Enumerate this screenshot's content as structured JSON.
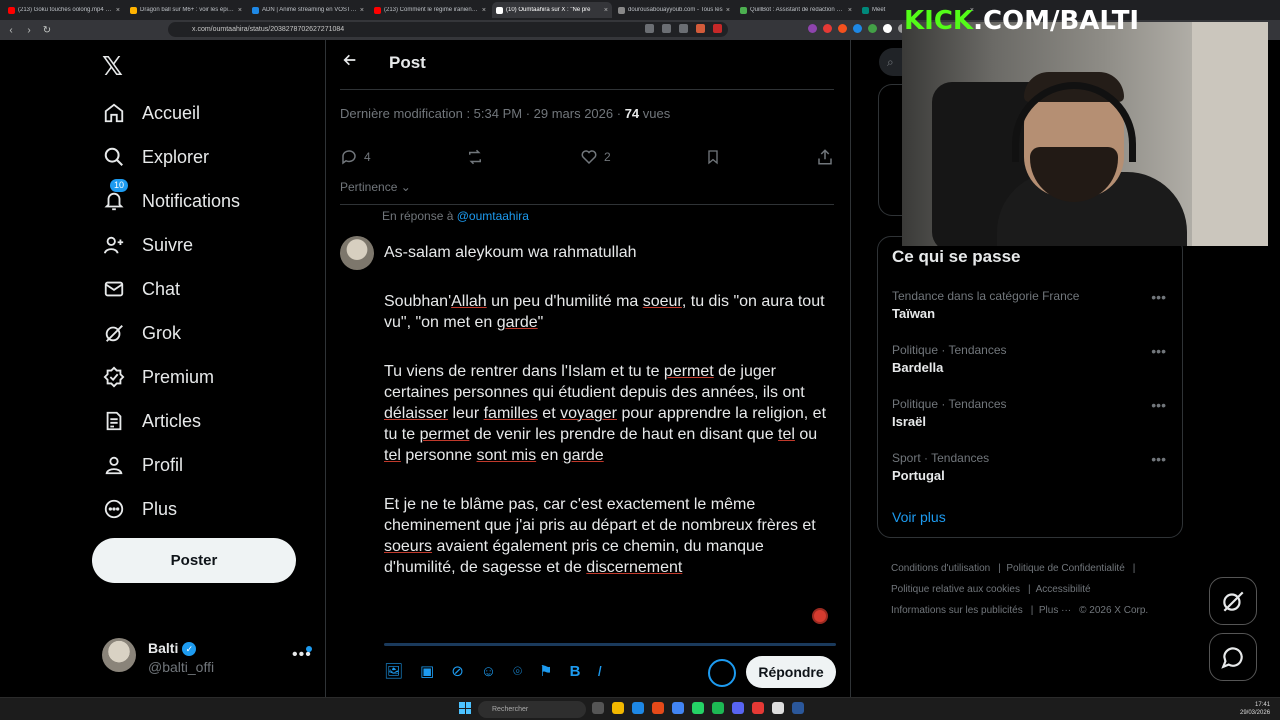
{
  "browser": {
    "tabs": [
      {
        "label": "(213) Goku touches oolong.mp4 - Yo",
        "color": "#ff0000"
      },
      {
        "label": "Dragon ball sur M6+ : voir les épisod",
        "color": "#ffb300"
      },
      {
        "label": "ADN | Anime streaming en VOSTFR",
        "color": "#1e88e5"
      },
      {
        "label": "(213) Comment le régime iranien réc",
        "color": "#ff0000"
      },
      {
        "label": "(10) Oumtaahira sur X : \"Ne pre",
        "color": "#ffffff",
        "active": true
      },
      {
        "label": "dourousabouayyoub.com - Tous les",
        "color": "#888888"
      },
      {
        "label": "QuillBot : Assistant de rédaction et c",
        "color": "#4caf50"
      },
      {
        "label": "Meet",
        "color": "#00897b"
      }
    ],
    "url": "x.com/oumtaahira/status/2038278702627271084"
  },
  "sidebar": {
    "logo": "𝕏",
    "items": [
      {
        "label": "Accueil",
        "icon": "home-icon"
      },
      {
        "label": "Explorer",
        "icon": "search-icon"
      },
      {
        "label": "Notifications",
        "icon": "bell-icon",
        "badge": "10"
      },
      {
        "label": "Suivre",
        "icon": "follow-icon"
      },
      {
        "label": "Chat",
        "icon": "mail-icon"
      },
      {
        "label": "Grok",
        "icon": "grok-icon"
      },
      {
        "label": "Premium",
        "icon": "premium-icon"
      },
      {
        "label": "Articles",
        "icon": "articles-icon"
      },
      {
        "label": "Profil",
        "icon": "profile-icon"
      },
      {
        "label": "Plus",
        "icon": "more-icon"
      }
    ],
    "post_button": "Poster",
    "account": {
      "name": "Balti",
      "handle": "@balti_offi",
      "more": "•••"
    }
  },
  "main": {
    "header_title": "Post",
    "meta": {
      "prefix": "Dernière modification : 5:34 PM · 29 mars 2026 · ",
      "views": "74",
      "views_label": " vues"
    },
    "actions": {
      "replies": "4",
      "likes": "2"
    },
    "sort_label": "Pertinence",
    "reply_to_prefix": "En réponse à ",
    "reply_to_handle": "@oumtaahira",
    "reply_button": "Répondre"
  },
  "right": {
    "trends_title": "Ce qui se passe",
    "trends": [
      {
        "category": "Tendance dans la catégorie France",
        "name": "Taïwan"
      },
      {
        "category": "Politique · Tendances",
        "name": "Bardella"
      },
      {
        "category": "Politique · Tendances",
        "name": "Israël"
      },
      {
        "category": "Sport · Tendances",
        "name": "Portugal"
      }
    ],
    "see_more": "Voir plus",
    "footer": [
      "Conditions d'utilisation",
      "Politique de Confidentialité",
      "Politique relative aux cookies",
      "Accessibilité",
      "Informations sur les publicités",
      "Plus ···",
      "© 2026 X Corp."
    ]
  },
  "overlay": {
    "kick_k": "KICK",
    "kick_rest": ".COM/BALTI"
  },
  "taskbar": {
    "search_placeholder": "Rechercher",
    "time": "17:41",
    "date": "29/03/2026"
  },
  "colors": {
    "accent": "#1d9bf0",
    "background": "#000000",
    "kick_green": "#53fc18"
  }
}
